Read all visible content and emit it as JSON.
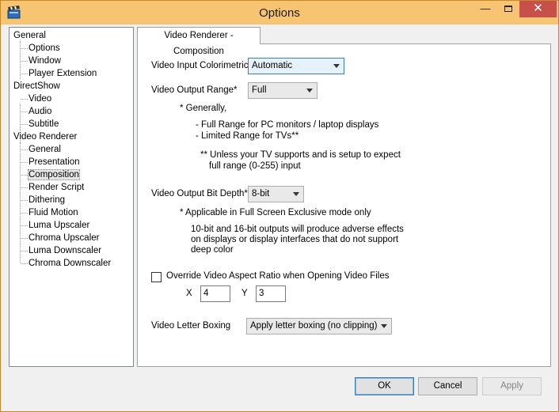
{
  "window": {
    "title": "Options"
  },
  "titlebar": {
    "minimize_icon": "minimize-icon",
    "maximize_icon": "maximize-icon",
    "close_icon": "close-icon"
  },
  "tree": [
    {
      "label": "General",
      "level": 0
    },
    {
      "label": "Options",
      "level": 1
    },
    {
      "label": "Window",
      "level": 1
    },
    {
      "label": "Player Extension",
      "level": 1
    },
    {
      "label": "DirectShow",
      "level": 0
    },
    {
      "label": "Video",
      "level": 1
    },
    {
      "label": "Audio",
      "level": 1
    },
    {
      "label": "Subtitle",
      "level": 1
    },
    {
      "label": "Video Renderer",
      "level": 0
    },
    {
      "label": "General",
      "level": 1
    },
    {
      "label": "Presentation",
      "level": 1
    },
    {
      "label": "Composition",
      "level": 1,
      "selected": true
    },
    {
      "label": "Render Script",
      "level": 1
    },
    {
      "label": "Dithering",
      "level": 1
    },
    {
      "label": "Fluid Motion",
      "level": 1
    },
    {
      "label": "Luma Upscaler",
      "level": 1
    },
    {
      "label": "Chroma Upscaler",
      "level": 1
    },
    {
      "label": "Luma Downscaler",
      "level": 1
    },
    {
      "label": "Chroma Downscaler",
      "level": 1
    }
  ],
  "tab": {
    "label": "Video Renderer - Composition"
  },
  "colorimetric": {
    "label": "Video Input Colorimetric",
    "value": "Automatic"
  },
  "output_range": {
    "label": "Video Output Range*",
    "value": "Full",
    "note_generally": "* Generally,",
    "note_full": "- Full Range for PC monitors / laptop displays",
    "note_limited": "- Limited Range for TVs**",
    "note_unless_1": "** Unless your TV supports and is setup to expect",
    "note_unless_2": "full range (0-255) input"
  },
  "bit_depth": {
    "label": "Video Output Bit Depth*",
    "value": "8-bit",
    "note_fse": "* Applicable in Full Screen Exclusive mode only",
    "note_1": "10-bit and 16-bit outputs will produce adverse effects",
    "note_2": "on displays or display interfaces that do not support",
    "note_3": "deep color"
  },
  "aspect": {
    "label": "Override Video Aspect Ratio when Opening Video Files",
    "checked": false,
    "x_label": "X",
    "x_value": "4",
    "y_label": "Y",
    "y_value": "3"
  },
  "letterbox": {
    "label": "Video Letter Boxing",
    "value": "Apply letter boxing (no clipping)"
  },
  "buttons": {
    "ok": "OK",
    "cancel": "Cancel",
    "apply": "Apply"
  }
}
